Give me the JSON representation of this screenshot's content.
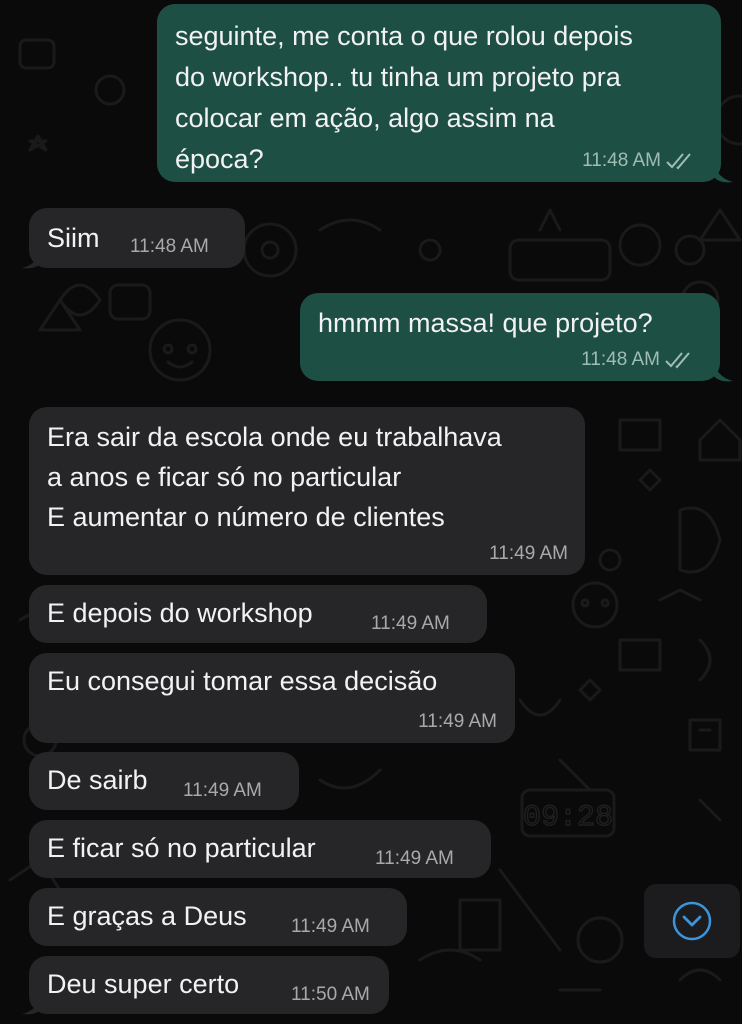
{
  "messages": [
    {
      "direction": "outgoing",
      "text": "seguinte, me conta o que rolou depois\ndo workshop.. tu tinha um projeto pra\ncolocar em ação, algo assim na\népoca?",
      "time": "11:48 AM",
      "status": "read"
    },
    {
      "direction": "incoming",
      "text": "Siim",
      "time": "11:48 AM"
    },
    {
      "direction": "outgoing",
      "text": "hmmm massa! que projeto?",
      "time": "11:48 AM",
      "status": "read"
    },
    {
      "direction": "incoming",
      "text": "Era sair da escola onde eu trabalhava\na anos  e ficar só no particular\nE aumentar o número de clientes",
      "time": "11:49 AM"
    },
    {
      "direction": "incoming",
      "text": "E depois do workshop",
      "time": "11:49 AM"
    },
    {
      "direction": "incoming",
      "text": "Eu consegui tomar essa decisão",
      "time": "11:49 AM"
    },
    {
      "direction": "incoming",
      "text": "De sairb",
      "time": "11:49 AM"
    },
    {
      "direction": "incoming",
      "text": "E ficar só no particular",
      "time": "11:49 AM"
    },
    {
      "direction": "incoming",
      "text": "E graças a Deus",
      "time": "11:49 AM"
    },
    {
      "direction": "incoming",
      "text": "Deu super certo",
      "time": "11:50 AM"
    }
  ],
  "wallpaper": {
    "clock_text": "09:28"
  },
  "scroll_to_bottom": {
    "icon": "chevron-down-circle-icon"
  },
  "colors": {
    "background": "#0a0a0a",
    "incoming_bubble": "#262628",
    "outgoing_bubble": "#1d4f45",
    "accent": "#3b95dc"
  }
}
